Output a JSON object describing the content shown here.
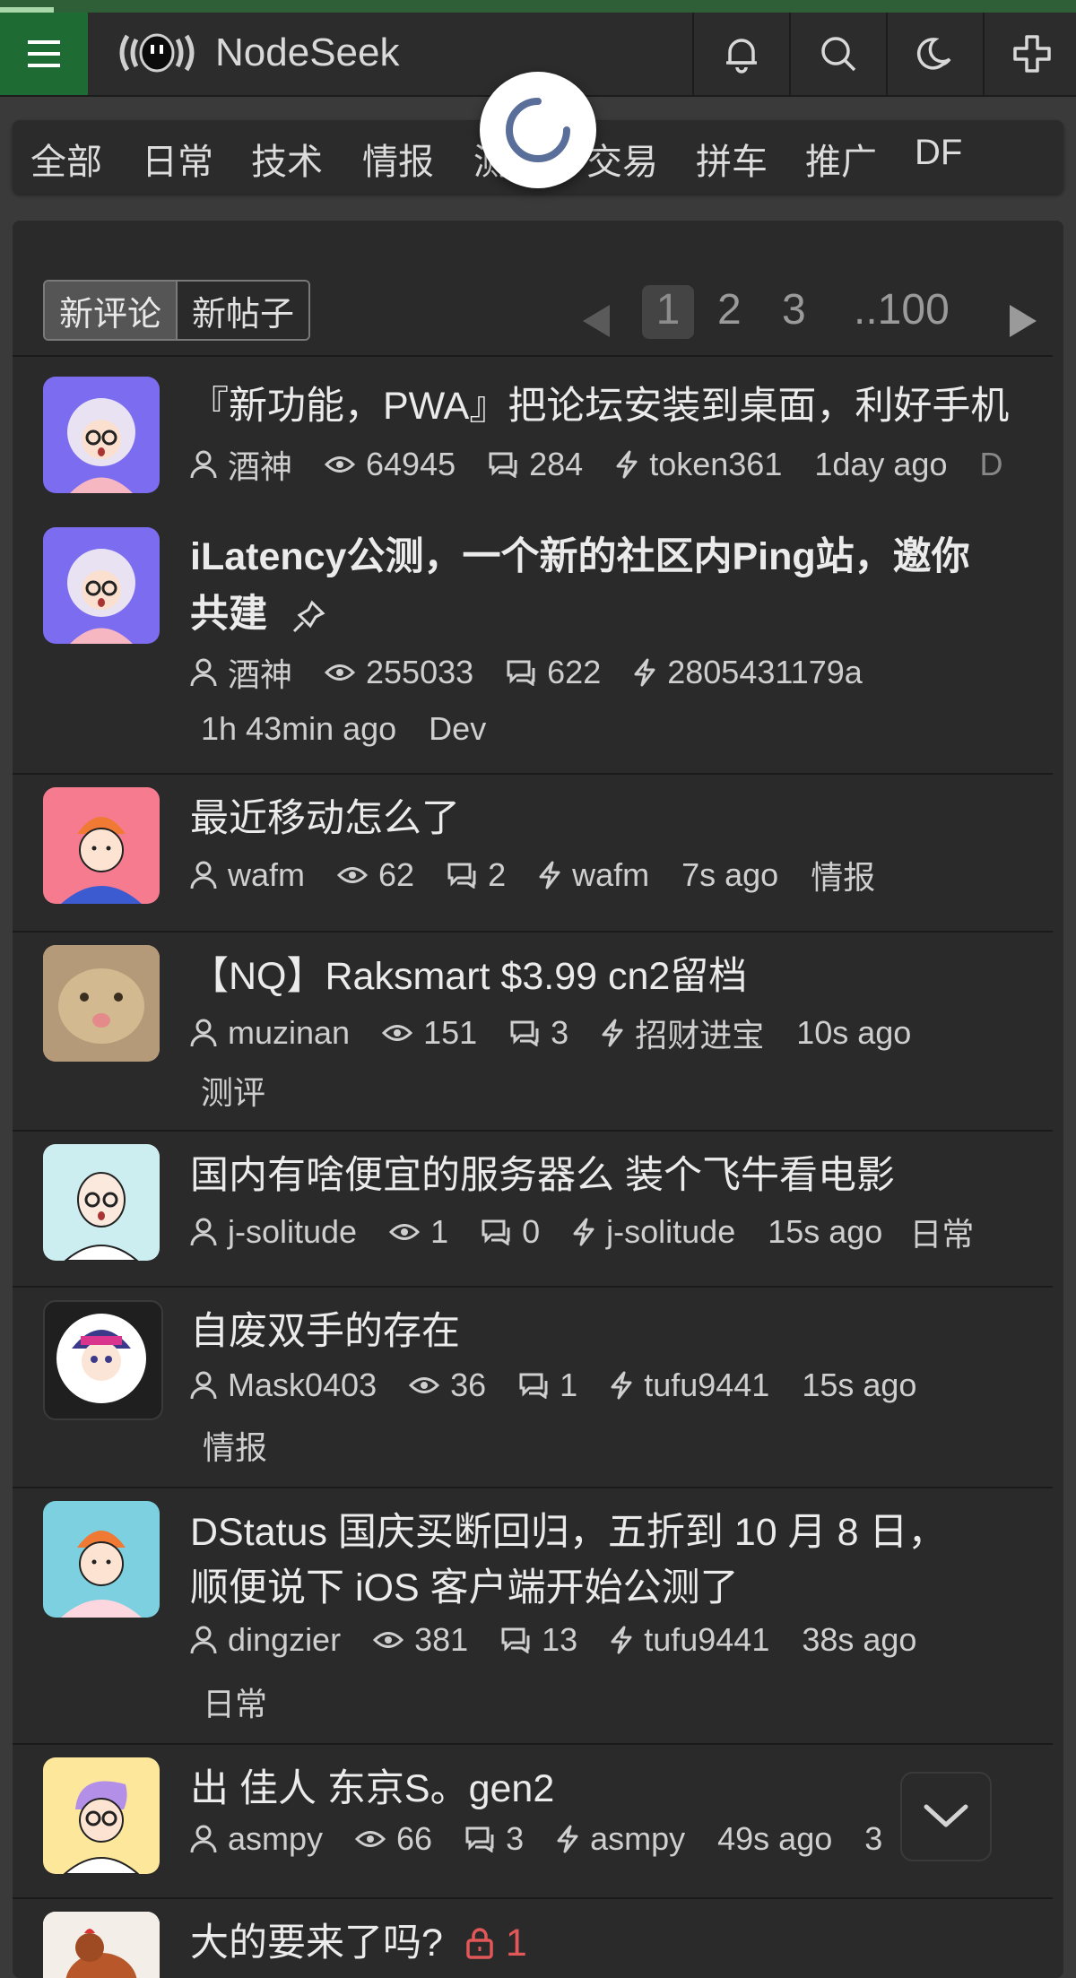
{
  "app": {
    "title": "NodeSeek"
  },
  "tabs": [
    "全部",
    "日常",
    "技术",
    "情报",
    "测",
    "交易",
    "拼车",
    "推广",
    "DF"
  ],
  "sort": {
    "new_comment": "新评论",
    "new_post": "新帖子"
  },
  "pager": {
    "p1": "1",
    "p2": "2",
    "p3": "3",
    "last": "..100"
  },
  "posts": [
    {
      "title": "『新功能，PWA』把论坛安装到桌面，利好手机",
      "author": "酒神",
      "views": "64945",
      "comments": "284",
      "last": "token361",
      "time": "1day ago",
      "tag": "D"
    },
    {
      "title1": "iLatency公测，一个新的社区内Ping站，邀你",
      "title2": "共建",
      "author": "酒神",
      "views": "255033",
      "comments": "622",
      "last": "2805431179a",
      "time": "1h 43min ago",
      "tag": "Dev"
    },
    {
      "title": "最近移动怎么了",
      "author": "wafm",
      "views": "62",
      "comments": "2",
      "last": "wafm",
      "time": "7s ago",
      "tag": "情报"
    },
    {
      "title": "【NQ】Raksmart $3.99 cn2留档",
      "author": "muzinan",
      "views": "151",
      "comments": "3",
      "last": "招财进宝",
      "time": "10s ago",
      "tag": "测评"
    },
    {
      "title": "国内有啥便宜的服务器么 装个飞牛看电影",
      "author": "j-solitude",
      "views": "1",
      "comments": "0",
      "last": "j-solitude",
      "time": "15s ago",
      "tag": "日常"
    },
    {
      "title": "自废双手的存在",
      "author": "Mask0403",
      "views": "36",
      "comments": "1",
      "last": "tufu9441",
      "time": "15s ago",
      "tag": "情报"
    },
    {
      "title1": "DStatus 国庆买断回归，五折到 10 月 8 日，",
      "title2": "顺便说下 iOS 客户端开始公测了",
      "author": "dingzier",
      "views": "381",
      "comments": "13",
      "last": "tufu9441",
      "time": "38s ago",
      "tag": "日常"
    },
    {
      "title": "出 佳人 东京S。gen2",
      "author": "asmpy",
      "views": "66",
      "comments": "3",
      "last": "asmpy",
      "time": "49s ago",
      "tag": "3"
    },
    {
      "title": "大的要来了吗?",
      "lock": "1"
    }
  ],
  "colors": {
    "accent": "#1f6b34",
    "panel": "#2a2a2a",
    "text": "#ebebeb"
  }
}
